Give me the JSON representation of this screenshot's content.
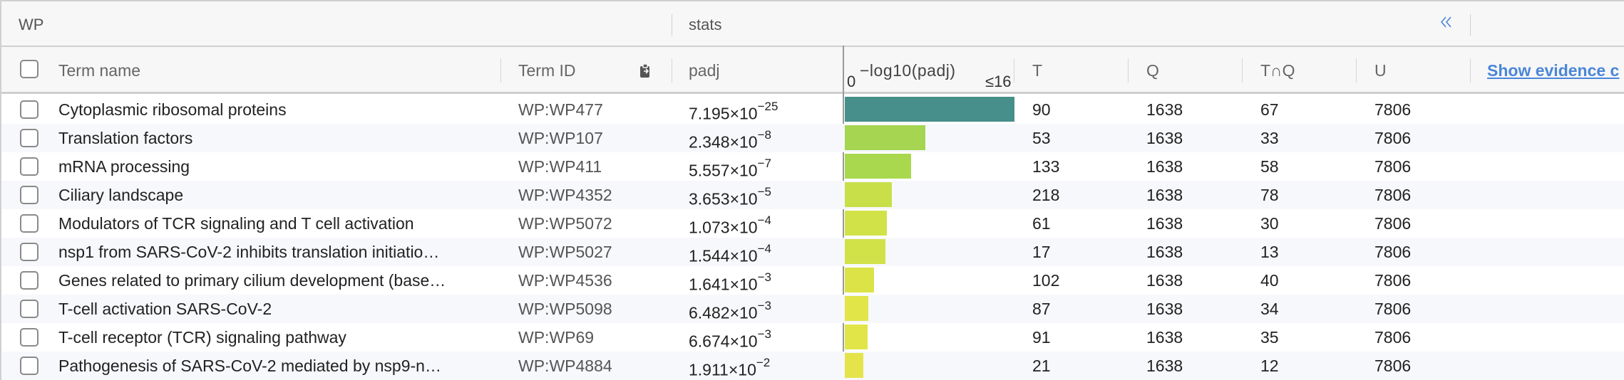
{
  "group_header": {
    "source_label": "WP",
    "stats_label": "stats",
    "collapse_icon": "double-chevron-left-icon"
  },
  "columns": {
    "term_name": "Term name",
    "term_id": "Term ID",
    "padj": "padj",
    "bar_label": "−log10(padj)",
    "bar_min": "0",
    "bar_max": "≤16",
    "t": "T",
    "q": "Q",
    "tq": "T∩Q",
    "u": "U",
    "show_evidence": "Show evidence c"
  },
  "bar_max_value": 16,
  "rows": [
    {
      "term": "Cytoplasmic ribosomal proteins",
      "id": "WP:WP477",
      "mant": "7.195",
      "exp": "-25",
      "neglog": 16,
      "color": "#468f8a",
      "T": "90",
      "Q": "1638",
      "TQ": "67",
      "U": "7806"
    },
    {
      "term": "Translation factors",
      "id": "WP:WP107",
      "mant": "2.348",
      "exp": "-8",
      "neglog": 7.63,
      "color": "#a5d551",
      "T": "53",
      "Q": "1638",
      "TQ": "33",
      "U": "7806"
    },
    {
      "term": "mRNA processing",
      "id": "WP:WP411",
      "mant": "5.557",
      "exp": "-7",
      "neglog": 6.26,
      "color": "#a9d84e",
      "T": "133",
      "Q": "1638",
      "TQ": "58",
      "U": "7806"
    },
    {
      "term": "Ciliary landscape",
      "id": "WP:WP4352",
      "mant": "3.653",
      "exp": "-5",
      "neglog": 4.44,
      "color": "#c9df4a",
      "T": "218",
      "Q": "1638",
      "TQ": "78",
      "U": "7806"
    },
    {
      "term": "Modulators of TCR signaling and T cell activation",
      "id": "WP:WP5072",
      "mant": "1.073",
      "exp": "-4",
      "neglog": 3.97,
      "color": "#d1e248",
      "T": "61",
      "Q": "1638",
      "TQ": "30",
      "U": "7806"
    },
    {
      "term": "nsp1 from SARS-CoV-2 inhibits translation initiatio…",
      "id": "WP:WP5027",
      "mant": "1.544",
      "exp": "-4",
      "neglog": 3.81,
      "color": "#d1e248",
      "T": "17",
      "Q": "1638",
      "TQ": "13",
      "U": "7806"
    },
    {
      "term": "Genes related to primary cilium development (base…",
      "id": "WP:WP4536",
      "mant": "1.641",
      "exp": "-3",
      "neglog": 2.78,
      "color": "#dbe346",
      "T": "102",
      "Q": "1638",
      "TQ": "40",
      "U": "7806"
    },
    {
      "term": "T-cell activation SARS-CoV-2",
      "id": "WP:WP5098",
      "mant": "6.482",
      "exp": "-3",
      "neglog": 2.19,
      "color": "#e1e548",
      "T": "87",
      "Q": "1638",
      "TQ": "34",
      "U": "7806"
    },
    {
      "term": "T-cell receptor (TCR) signaling pathway",
      "id": "WP:WP69",
      "mant": "6.674",
      "exp": "-3",
      "neglog": 2.18,
      "color": "#e1e548",
      "T": "91",
      "Q": "1638",
      "TQ": "35",
      "U": "7806"
    },
    {
      "term": "Pathogenesis of SARS-CoV-2 mediated by nsp9-n…",
      "id": "WP:WP4884",
      "mant": "1.911",
      "exp": "-2",
      "neglog": 1.72,
      "color": "#e4e44a",
      "T": "21",
      "Q": "1638",
      "TQ": "12",
      "U": "7806"
    }
  ]
}
